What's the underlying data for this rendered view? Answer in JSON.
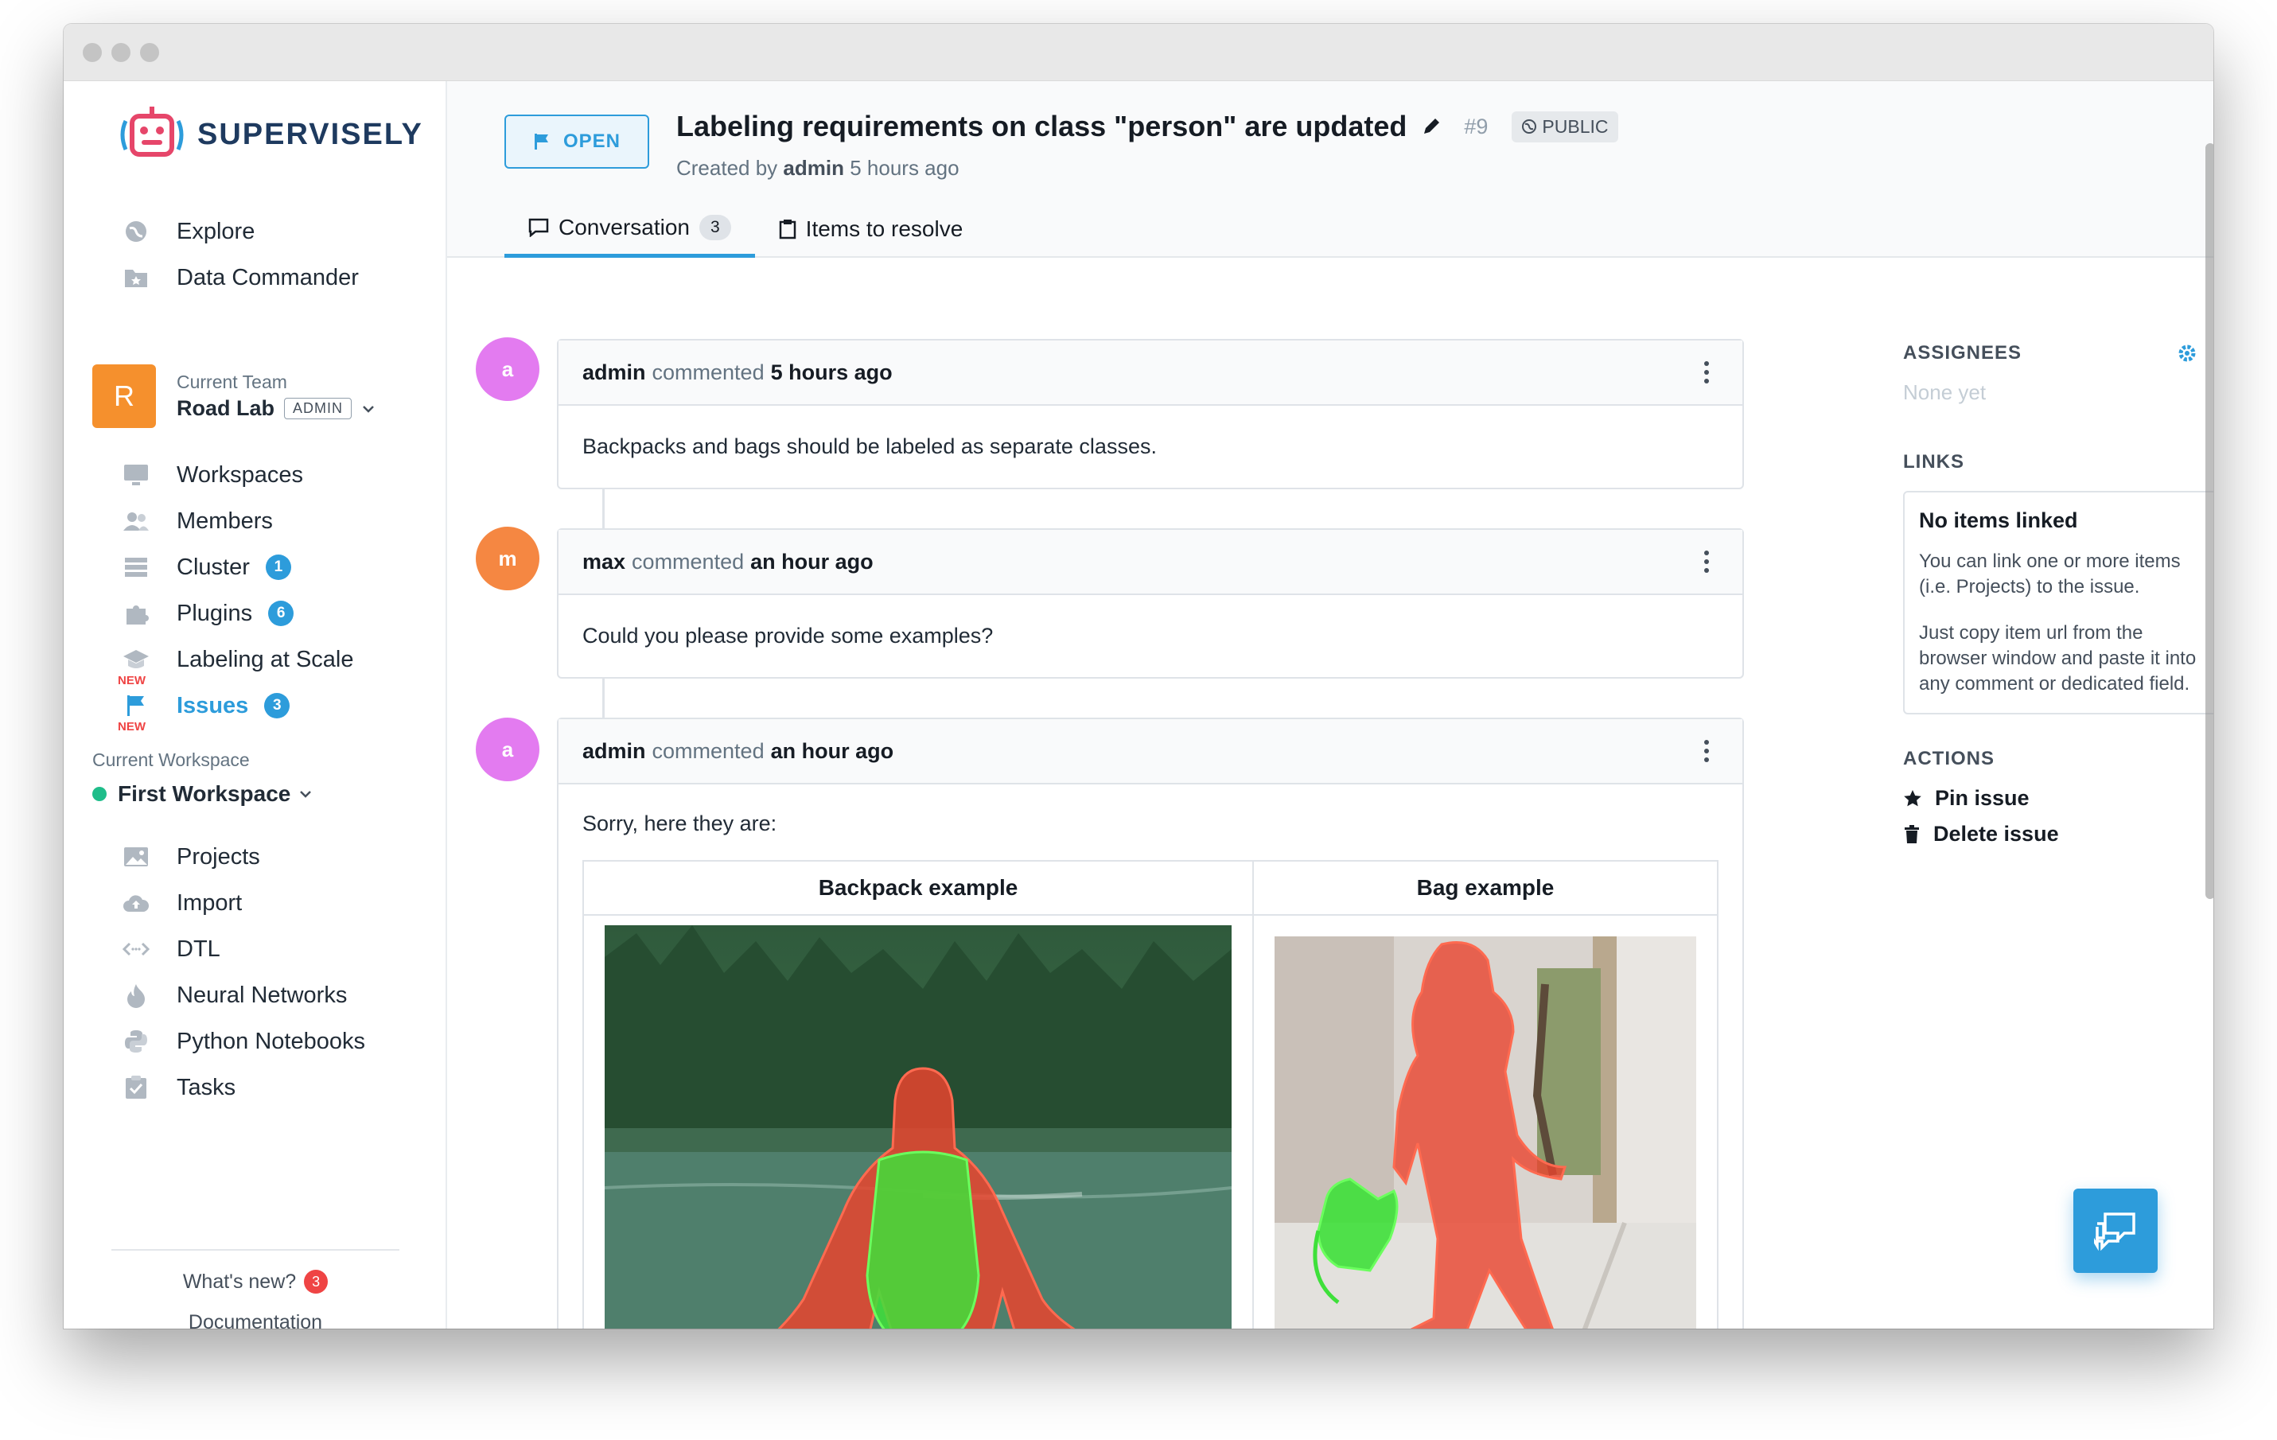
{
  "app": {
    "logo_text": "SUPERVISELY"
  },
  "sidebar": {
    "top_items": [
      {
        "label": "Explore",
        "icon": "globe-icon"
      },
      {
        "label": "Data Commander",
        "icon": "folder-star-icon"
      }
    ],
    "team": {
      "initial": "R",
      "caption": "Current Team",
      "name": "Road Lab",
      "role": "ADMIN"
    },
    "team_items": [
      {
        "label": "Workspaces",
        "icon": "monitor-icon"
      },
      {
        "label": "Members",
        "icon": "people-icon"
      },
      {
        "label": "Cluster",
        "icon": "server-icon",
        "badge": "1"
      },
      {
        "label": "Plugins",
        "icon": "puzzle-icon",
        "badge": "6"
      },
      {
        "label": "Labeling at Scale",
        "icon": "graduation-cap-icon",
        "tag": "NEW"
      },
      {
        "label": "Issues",
        "icon": "flag-icon",
        "badge": "3",
        "tag": "NEW"
      }
    ],
    "workspace": {
      "caption": "Current Workspace",
      "name": "First Workspace"
    },
    "workspace_items": [
      {
        "label": "Projects",
        "icon": "images-icon"
      },
      {
        "label": "Import",
        "icon": "cloud-upload-icon"
      },
      {
        "label": "DTL",
        "icon": "code-icon"
      },
      {
        "label": "Neural Networks",
        "icon": "flame-icon"
      },
      {
        "label": "Python Notebooks",
        "icon": "python-icon"
      },
      {
        "label": "Tasks",
        "icon": "checklist-icon"
      }
    ],
    "footer": {
      "whats_new": "What's new?",
      "whats_new_count": "3",
      "docs": "Documentation"
    }
  },
  "issue": {
    "status": "OPEN",
    "title": "Labeling requirements on class \"person\" are updated",
    "number": "#9",
    "visibility": "PUBLIC",
    "created_prefix": "Created by",
    "author": "admin",
    "created_ago": "5 hours ago"
  },
  "tabs": [
    {
      "label": "Conversation",
      "count": "3"
    },
    {
      "label": "Items to resolve"
    }
  ],
  "comments": [
    {
      "avatar": "a",
      "avatar_color": "#e37bf0",
      "author": "admin",
      "verb": "commented",
      "time": "5 hours ago",
      "text": "Backpacks and bags should be labeled as separate classes."
    },
    {
      "avatar": "m",
      "avatar_color": "#f58742",
      "author": "max",
      "verb": "commented",
      "time": "an hour ago",
      "text": "Could you please provide some examples?"
    },
    {
      "avatar": "a",
      "avatar_color": "#e37bf0",
      "author": "admin",
      "verb": "commented",
      "time": "an hour ago",
      "text": "Sorry, here they are:"
    }
  ],
  "examples": [
    {
      "title": "Backpack example"
    },
    {
      "title": "Bag example"
    }
  ],
  "right_panel": {
    "assignees_title": "ASSIGNEES",
    "assignees_value": "None yet",
    "links_title": "LINKS",
    "links_box_title": "No items linked",
    "links_p1": "You can link one or more items (i.e. Projects) to the issue.",
    "links_p2": "Just copy item url from the browser window and paste it into any comment or dedicated field.",
    "actions_title": "ACTIONS",
    "pin": "Pin issue",
    "delete": "Delete issue"
  },
  "colors": {
    "accent": "#2d9cdb",
    "person_mask": "#e8442e",
    "object_mask": "#3ee03a"
  }
}
